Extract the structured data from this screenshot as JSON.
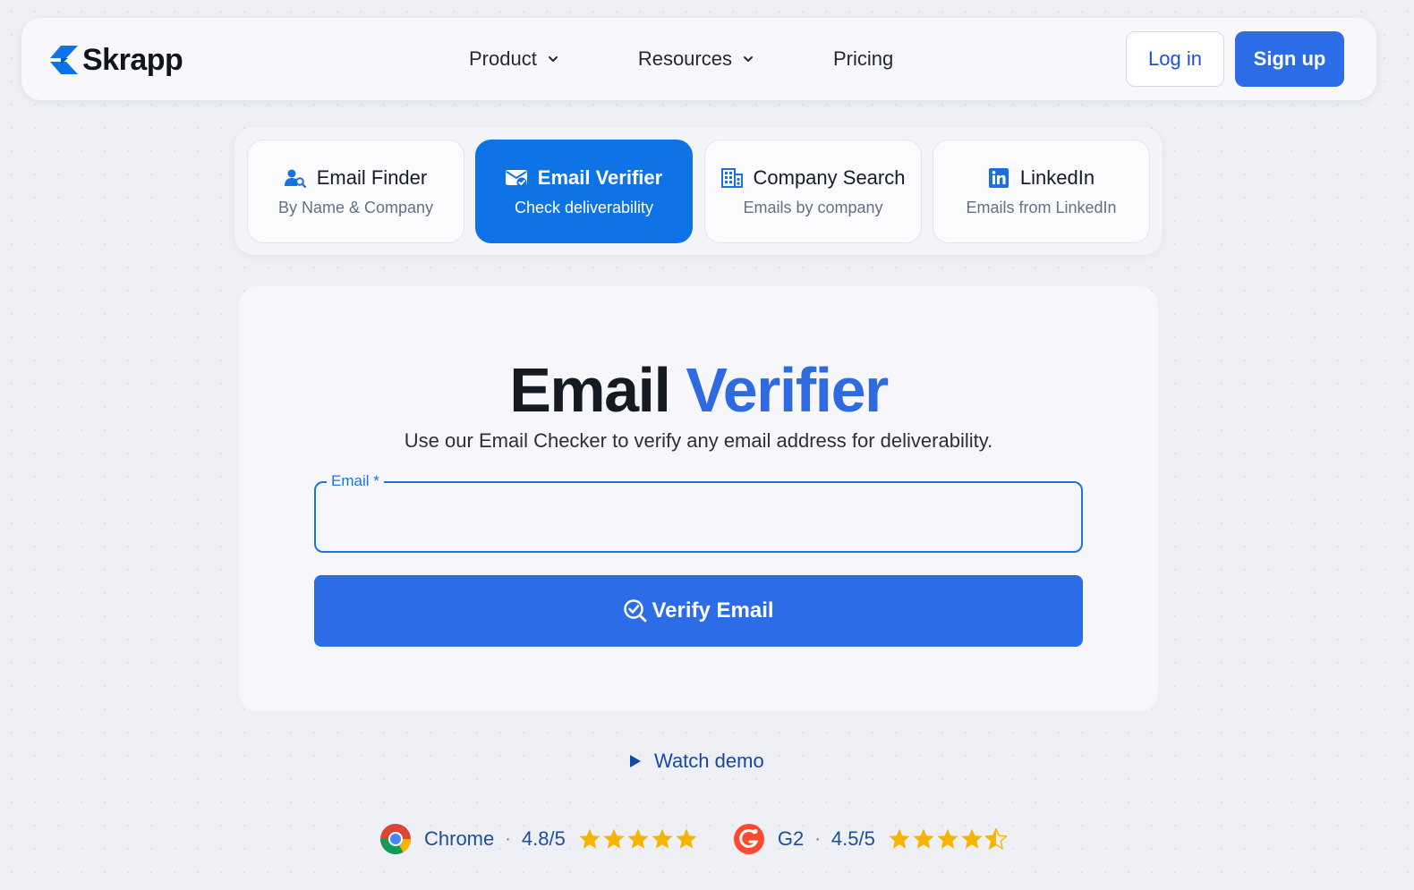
{
  "brand": {
    "name": "Skrapp",
    "color": "#0f73e8"
  },
  "nav": {
    "items": [
      {
        "label": "Product",
        "has_dropdown": true
      },
      {
        "label": "Resources",
        "has_dropdown": true
      },
      {
        "label": "Pricing",
        "has_dropdown": false
      }
    ],
    "login_label": "Log in",
    "signup_label": "Sign up"
  },
  "tabs": [
    {
      "title": "Email Finder",
      "subtitle": "By Name & Company",
      "icon": "user-search-icon",
      "active": false
    },
    {
      "title": "Email Verifier",
      "subtitle": "Check deliverability",
      "icon": "mail-check-icon",
      "active": true
    },
    {
      "title": "Company Search",
      "subtitle": "Emails by company",
      "icon": "building-icon",
      "active": false
    },
    {
      "title": "LinkedIn",
      "subtitle": "Emails from LinkedIn",
      "icon": "linkedin-icon",
      "active": false
    }
  ],
  "main": {
    "heading_dark": "Email",
    "heading_blue": "Verifier",
    "subtitle": "Use our Email Checker to verify any email address for deliverability.",
    "email_label": "Email *",
    "email_value": "",
    "verify_label": "Verify Email"
  },
  "watch_demo_label": "Watch demo",
  "ratings": [
    {
      "name": "Chrome",
      "separator": "·",
      "score": "4.8/5",
      "stars": 5,
      "logo": "chrome-logo-icon"
    },
    {
      "name": "G2",
      "separator": "·",
      "score": "4.5/5",
      "stars": 4.5,
      "logo": "g2-logo-icon"
    }
  ],
  "colors": {
    "primary": "#2c6ce6",
    "active_tab": "#0f73e8",
    "heading_accent": "#2f6be0",
    "star": "#f5b400",
    "link": "#1747a6"
  }
}
